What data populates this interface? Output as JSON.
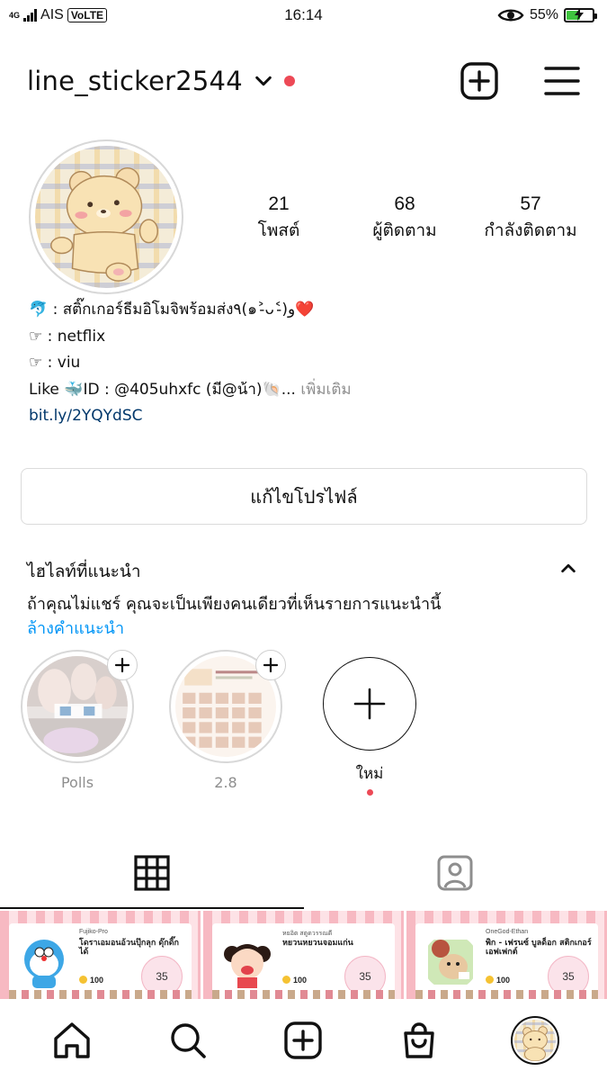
{
  "status_bar": {
    "network": "4G",
    "carrier": "AIS",
    "volte": "VoLTE",
    "time": "16:14",
    "battery": "55%",
    "battery_level": 0.55,
    "battery_color": "#3ec43e"
  },
  "header": {
    "username": "line_sticker2544",
    "icons": [
      "chevron-down-icon",
      "notification-dot",
      "new-post-icon",
      "menu-icon"
    ]
  },
  "profile": {
    "stats": [
      {
        "count": "21",
        "label": "โพสต์"
      },
      {
        "count": "68",
        "label": "ผู้ติดตาม"
      },
      {
        "count": "57",
        "label": "กำลังติดตาม"
      }
    ],
    "bio": {
      "line1": "🐬 : สติ๊กเกอร์ธีมอิโมจิพร้อมส่ง٩(๑˃̵ᴗ˂̵)و❤️",
      "line2": "☞ : netflix",
      "line3": "☞ : viu",
      "line4_text": "Like 🐳ID : @405uhxfc (มี@น้า)🐚...",
      "line4_more": " เพิ่มเติม",
      "link": "bit.ly/2YQYdSC"
    },
    "edit_button": "แก้ไขโปรไฟล์"
  },
  "highlights": {
    "title": "ไฮไลท์ที่แนะนำ",
    "description": "ถ้าคุณไม่แชร์ คุณจะเป็นเพียงคนเดียวที่เห็นรายการแนะนำนี้",
    "clear": "ล้างคำแนะนำ",
    "items": [
      {
        "label": "Polls"
      },
      {
        "label": "2.8"
      }
    ],
    "new_label": "ใหม่"
  },
  "tabs": [
    "grid-icon",
    "tagged-icon"
  ],
  "posts": [
    {
      "author": "Fujiko-Pro",
      "name": "โดราเอมอนอ้วนปุ๊กลุก ดุ๊กดิ๊กได้",
      "price": "100",
      "badge": "35"
    },
    {
      "author": "หยอิต สตูดวรรณดี",
      "name": "หยวนหยวนจอมแก่น",
      "price": "100",
      "badge": "35"
    },
    {
      "author": "OneGod-Ethan",
      "name": "พิก - เฟรนซ์ บูลด็อก สติกเกอร์เอฟเฟกต์",
      "price": "100",
      "badge": "35"
    }
  ],
  "bottom_nav": [
    "home-icon",
    "search-icon",
    "create-icon",
    "shop-icon",
    "profile-avatar"
  ],
  "colors": {
    "accent_link": "#0095f6",
    "notification_red": "#ed4956",
    "bio_link": "#00376b",
    "muted": "#8e8e8e"
  }
}
